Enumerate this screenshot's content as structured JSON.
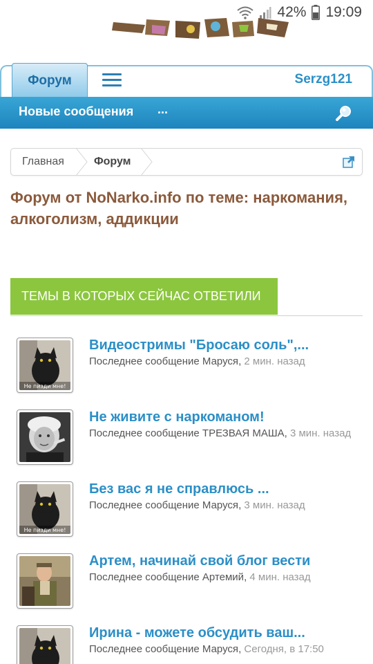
{
  "status_bar": {
    "battery": "42%",
    "time": "19:09",
    "icons": [
      "wifi-icon",
      "signal-icon",
      "battery-icon"
    ]
  },
  "nav": {
    "tab_forum": "Форум",
    "menu_icon": "hamburger-menu-icon",
    "username": "Serzg121"
  },
  "subnav": {
    "new_posts": "Новые сообщения",
    "more": "...",
    "search_icon": "search-icon"
  },
  "breadcrumb": {
    "home": "Главная",
    "forum": "Форум",
    "popout_icon": "popout-icon"
  },
  "page": {
    "title": "Форум от NoNarko.info по теме: наркомания, алкоголизм, аддикции"
  },
  "section": {
    "header": "ТЕМЫ В КОТОРЫХ СЕЙЧАС ОТВЕТИЛИ"
  },
  "threads": [
    {
      "title": "Видеостримы \"Бросаю соль\",...",
      "meta_label": "Последнее сообщение",
      "author": "Маруся",
      "time": "2 мин. назад",
      "avatar": "cat",
      "avatar_caption": "Не пизди мне!"
    },
    {
      "title": "Не живите с наркоманом!",
      "meta_label": "Последнее сообщение",
      "author": "ТРЕЗВАЯ МАША",
      "time": "3 мин. назад",
      "avatar": "woman"
    },
    {
      "title": "Без вас я не справлюсь ...",
      "meta_label": "Последнее сообщение",
      "author": "Маруся",
      "time": "3 мин. назад",
      "avatar": "cat",
      "avatar_caption": "Не пизди мне!"
    },
    {
      "title": "Артем, начинай свой блог вести",
      "meta_label": "Последнее сообщение",
      "author": "Артемий",
      "time": "4 мин. назад",
      "avatar": "man"
    },
    {
      "title": "Ирина - можете обсудить ваш...",
      "meta_label": "Последнее сообщение",
      "author": "Маруся",
      "time": "Сегодня, в 17:50",
      "avatar": "cat"
    }
  ],
  "colors": {
    "accent_blue": "#2b8fc7",
    "subnav_blue": "#1d84bd",
    "section_green": "#8cc63f",
    "title_brown": "#8b5a3c"
  }
}
